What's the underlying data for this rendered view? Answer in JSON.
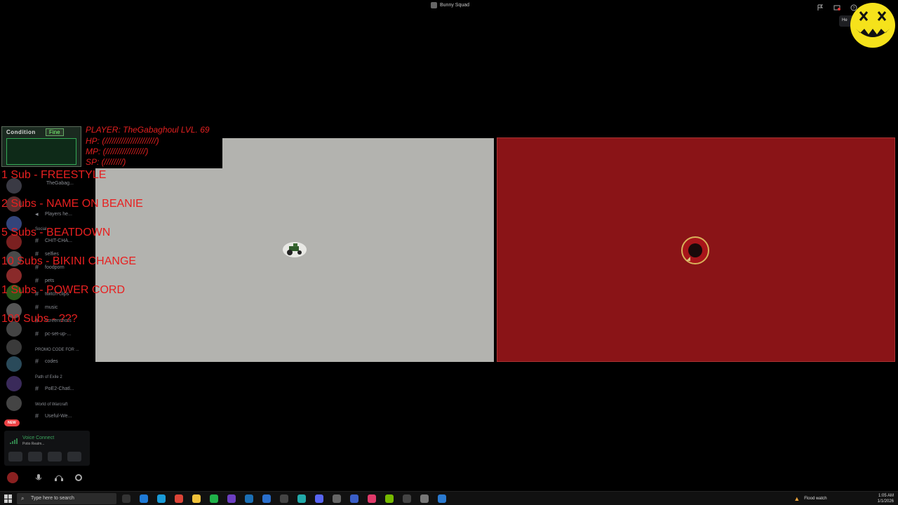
{
  "window": {
    "title": "Bunny Squad",
    "help_tooltip": "He"
  },
  "channels": {
    "user_entry": "TheGabag...",
    "voice_players": "Players he...",
    "categories": [
      "Social",
      "PROMO CODE FOR ...",
      "Path of Exile 2",
      "World of Warcraft"
    ],
    "items": [
      {
        "name": "CHIT-CHA..."
      },
      {
        "name": "selfies"
      },
      {
        "name": "foodporn"
      },
      {
        "name": "pets"
      },
      {
        "name": "twitch-clips"
      },
      {
        "name": "music"
      },
      {
        "name": "screenshots"
      },
      {
        "name": "pc-set-up-..."
      },
      {
        "name": "codes"
      },
      {
        "name": "PoE2-Chatl..."
      },
      {
        "name": "Useful-We..."
      }
    ],
    "new_badge": "NEW",
    "voice_connect": {
      "title": "Voice Connect",
      "subtitle": "Potio Realm..."
    }
  },
  "overlay": {
    "condition_label": "Condition",
    "condition_status": "Fine",
    "player": "PLAYER: TheGabaghoul LVL. 69",
    "hp": "HP:   (//////////////////////)",
    "mp": "MP:   (/////////////////)",
    "sp": "SP: (////////)",
    "sub_goals": [
      "1 Sub - FREESTYLE",
      "2 Subs - NAME ON BEANIE",
      "5 Subs - BEATDOWN",
      "10 Subs - BIKINI CHANGE",
      "1 Subs - POWER CORD",
      "100 Subs - ???"
    ]
  },
  "panels": {
    "left_color": "#b3b3af",
    "right_color": "#8a1417"
  },
  "taskbar": {
    "search_placeholder": "Type here to search",
    "weather": "Flood watch",
    "time": "1:05 AM",
    "date": "1/1/2026"
  }
}
